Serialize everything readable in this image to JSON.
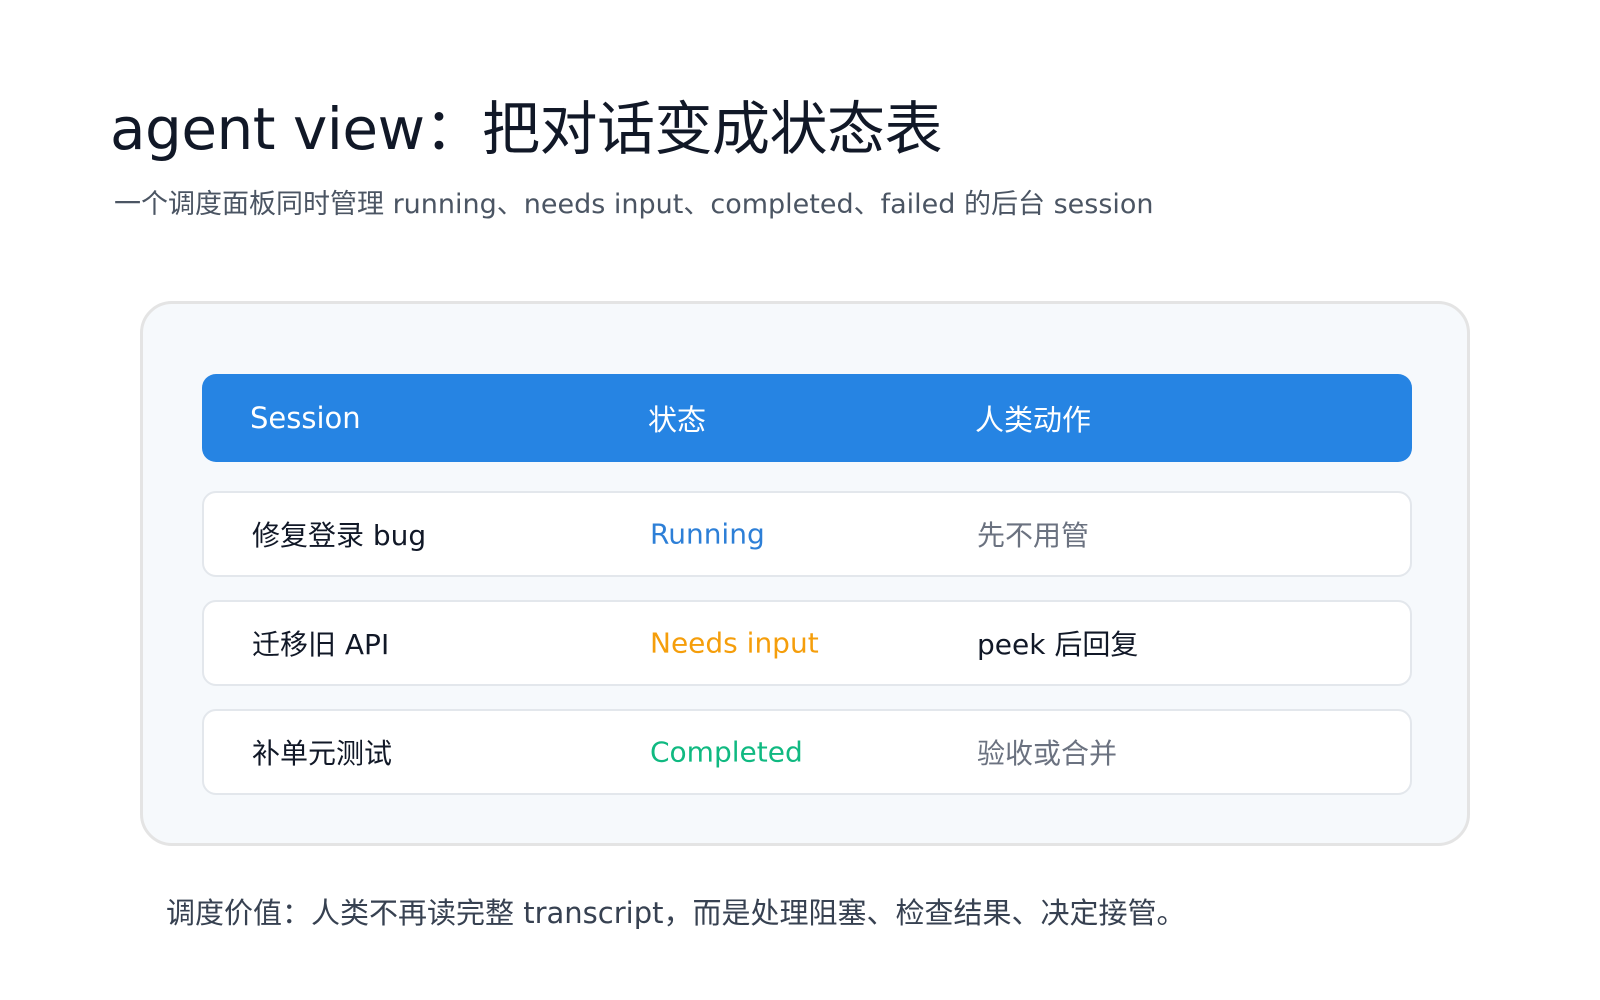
{
  "page": {
    "title": "agent view：把对话变成状态表",
    "subtitle": "一个调度面板同时管理 running、needs input、completed、failed 的后台 session",
    "footer_note": "调度价值：人类不再读完整 transcript，而是处理阻塞、检查结果、决定接管。"
  },
  "table": {
    "columns": [
      "Session",
      "状态",
      "人类动作"
    ],
    "rows": [
      {
        "session": "修复登录 bug",
        "status": "Running",
        "action": "先不用管"
      },
      {
        "session": "迁移旧 API",
        "status": "Needs input",
        "action": "peek 后回复"
      },
      {
        "session": "补单元测试",
        "status": "Completed",
        "action": "验收或合并"
      }
    ]
  },
  "colors": {
    "header_blue": "#2684e3",
    "running": "#2d7fd7",
    "needs_input": "#f59e0b",
    "completed": "#10b981",
    "muted_text": "#6b7280"
  }
}
